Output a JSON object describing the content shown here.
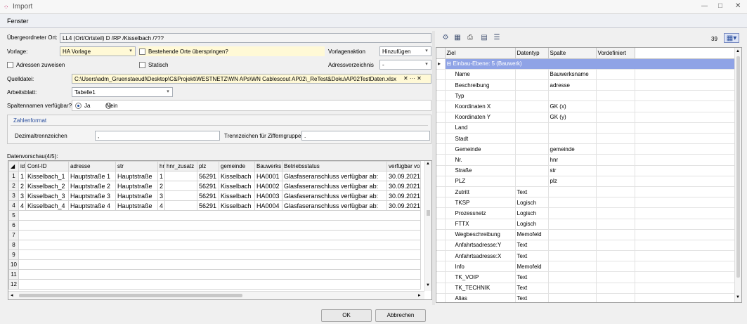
{
  "window": {
    "title": "Import",
    "controls": [
      "—",
      "□",
      "✕"
    ]
  },
  "menu": {
    "fenster": "Fenster"
  },
  "form": {
    "uebergeordnet_label": "Übergeordneter Ort:",
    "uebergeordnet_value": "LL4 (Ort/Ortsteil) D /RP /Kisselbach /???",
    "vorlage_label": "Vorlage:",
    "vorlage_value": "HA Vorlage",
    "bestehende_label": "Bestehende Orte überspringen?",
    "vorlagenaktion_label": "Vorlagenaktion",
    "vorlagenaktion_value": "Hinzufügen",
    "adressen_label": "Adressen zuweisen",
    "statisch_label": "Statisch",
    "adressverzeichnis_label": "Adressverzeichnis",
    "adressverzeichnis_value": "-",
    "quelldatei_label": "Quelldatei:",
    "quelldatei_value": "C:\\Users\\adm_Gruenstaeudl\\Desktop\\C&Projekt\\WESTNETZ\\WN APs\\WN Cablescout AP02\\_ReTest&Doku\\AP02TestDaten.xlsx",
    "quelldatei_btns": "✕  ···  ✕",
    "arbeitsblatt_label": "Arbeitsblatt:",
    "arbeitsblatt_value": "Tabelle1",
    "spaltennamen_label": "Spaltennamen verfügbar?",
    "ja": "Ja",
    "nein": "Nein",
    "zahlenformat_title": "Zahlenformat",
    "dezimal_label": "Dezimaltrennzeichen",
    "dezimal_value": ",",
    "tausender_label": "Trennzeichen für Zifferngruppe",
    "tausender_value": ".",
    "datenvorschau_label": "Datenvorschau(4/5):"
  },
  "preview": {
    "headers": [
      "id",
      "Cont-ID",
      "adresse",
      "str",
      "hnr",
      "hnr_zusatz",
      "plz",
      "gemeinde",
      "Bauwerks",
      "Betriebsstatus",
      "verfügbar vo"
    ],
    "rows": [
      [
        "1",
        "Kisselbach_1",
        "Hauptstraße 1",
        "Hauptstraße",
        "1",
        "",
        "56291",
        "Kisselbach",
        "HA0001",
        "Glasfaseranschluss verfügbar ab:",
        "30.09.2021"
      ],
      [
        "2",
        "Kisselbach_2",
        "Hauptstraße 2",
        "Hauptstraße",
        "2",
        "",
        "56291",
        "Kisselbach",
        "HA0002",
        "Glasfaseranschluss verfügbar ab:",
        "30.09.2021"
      ],
      [
        "3",
        "Kisselbach_3",
        "Hauptstraße 3",
        "Hauptstraße",
        "3",
        "",
        "56291",
        "Kisselbach",
        "HA0003",
        "Glasfaseranschluss verfügbar ab:",
        "30.09.2021"
      ],
      [
        "4",
        "Kisselbach_4",
        "Hauptstraße 4",
        "Hauptstraße",
        "4",
        "",
        "56291",
        "Kisselbach",
        "HA0004",
        "Glasfaseranschluss verfügbar ab:",
        "30.09.2021"
      ]
    ],
    "row_numbers": [
      "1",
      "2",
      "3",
      "4",
      "5",
      "6",
      "7",
      "8",
      "9",
      "10",
      "11",
      "12"
    ]
  },
  "right": {
    "count": "39",
    "headers": [
      "Ziel",
      "Datentyp",
      "Spalte",
      "Vordefiniert"
    ],
    "group": "Einbau-Ebene: 5 (Bauwerk)",
    "rows": [
      [
        "Name",
        "",
        "Bauwerksname"
      ],
      [
        "Beschreibung",
        "",
        "adresse"
      ],
      [
        "Typ",
        "",
        ""
      ],
      [
        "Koordinaten X",
        "",
        "GK (x)"
      ],
      [
        "Koordinaten Y",
        "",
        "GK (y)"
      ],
      [
        "Land",
        "",
        ""
      ],
      [
        "Stadt",
        "",
        ""
      ],
      [
        "Gemeinde",
        "",
        "gemeinde"
      ],
      [
        "Nr.",
        "",
        "hnr"
      ],
      [
        "Straße",
        "",
        "str"
      ],
      [
        "PLZ",
        "",
        "plz"
      ],
      [
        "Zutritt",
        "Text",
        ""
      ],
      [
        "TKSP",
        "Logisch",
        ""
      ],
      [
        "Prozessnetz",
        "Logisch",
        ""
      ],
      [
        "FTTX",
        "Logisch",
        ""
      ],
      [
        "Wegbeschreibung",
        "Memofeld",
        ""
      ],
      [
        "Anfahrtsadresse:Y",
        "Text",
        ""
      ],
      [
        "Anfahrtsadresse:X",
        "Text",
        ""
      ],
      [
        "Info",
        "Memofeld",
        ""
      ],
      [
        "TK_VOIP",
        "Text",
        ""
      ],
      [
        "TK_TECHNIK",
        "Text",
        ""
      ],
      [
        "Alias",
        "Text",
        ""
      ]
    ]
  },
  "buttons": {
    "ok": "OK",
    "cancel": "Abbrechen"
  },
  "colors": {
    "group_row": "#8fa3e6",
    "selected_field": "#fff9d6"
  }
}
